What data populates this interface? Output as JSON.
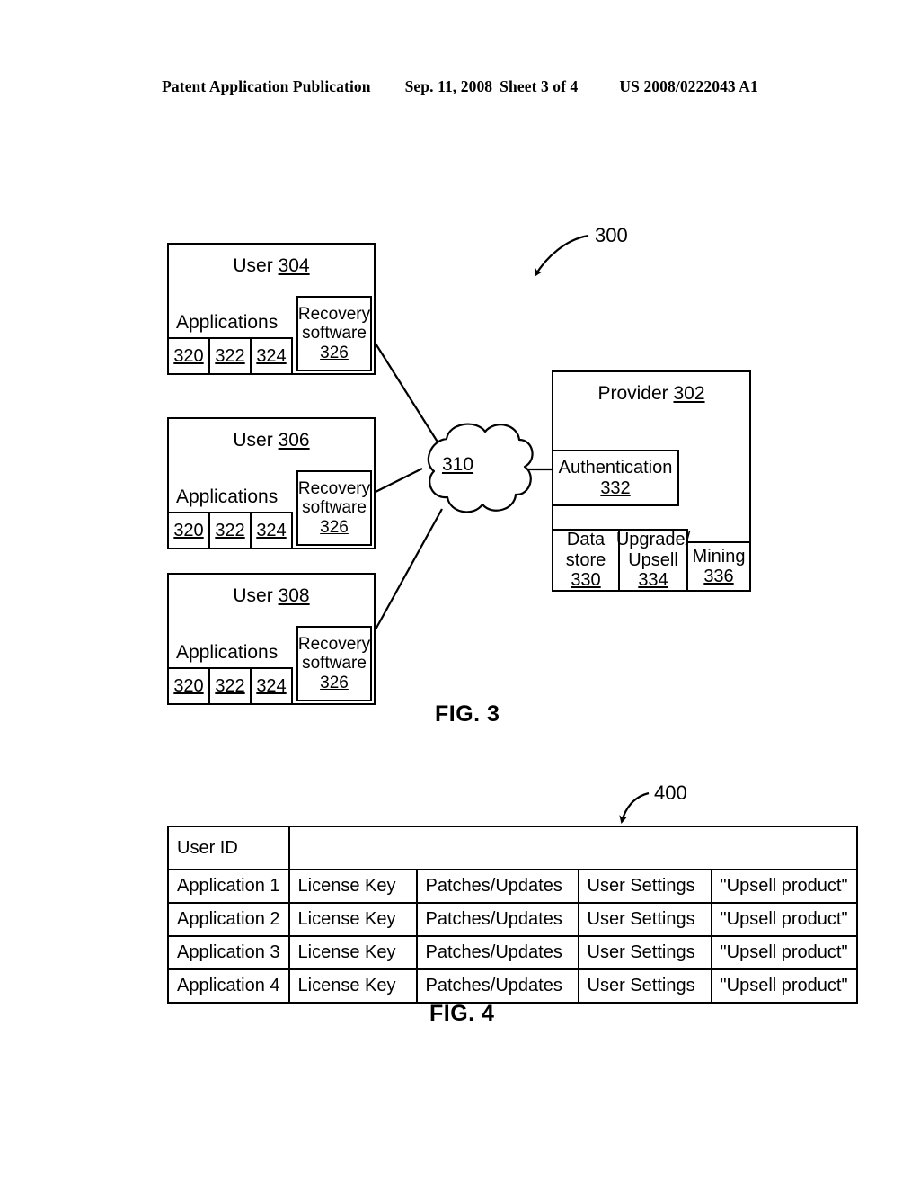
{
  "header": {
    "publication": "Patent Application Publication",
    "date": "Sep. 11, 2008",
    "sheet": "Sheet 3 of 4",
    "patent_number": "US 2008/0222043 A1"
  },
  "figure3": {
    "caption": "FIG. 3",
    "reference_label": "300",
    "cloud": {
      "name": "network-cloud",
      "label": "310"
    },
    "users": [
      {
        "title_text": "User",
        "title_ref": "304",
        "applications_label": "Applications",
        "app_refs": [
          "320",
          "322",
          "324"
        ],
        "recovery": {
          "line1": "Recovery",
          "line2": "software",
          "ref": "326"
        }
      },
      {
        "title_text": "User",
        "title_ref": "306",
        "applications_label": "Applications",
        "app_refs": [
          "320",
          "322",
          "324"
        ],
        "recovery": {
          "line1": "Recovery",
          "line2": "software",
          "ref": "326"
        }
      },
      {
        "title_text": "User",
        "title_ref": "308",
        "applications_label": "Applications",
        "app_refs": [
          "320",
          "322",
          "324"
        ],
        "recovery": {
          "line1": "Recovery",
          "line2": "software",
          "ref": "326"
        }
      }
    ],
    "provider": {
      "title_text": "Provider",
      "title_ref": "302",
      "authentication": {
        "label": "Authentication",
        "ref": "332"
      },
      "modules": [
        {
          "line1": "Data",
          "line2": "store",
          "ref": "330"
        },
        {
          "line1": "Upgrade/",
          "line2": "Upsell",
          "ref": "334"
        },
        {
          "line1": "Mining",
          "line2": "",
          "ref": "336"
        }
      ]
    }
  },
  "figure4": {
    "caption": "FIG. 4",
    "reference_label": "400",
    "table": {
      "header_row": [
        "User ID",
        ""
      ],
      "rows": [
        [
          "Application 1",
          "License Key",
          "Patches/Updates",
          "User Settings",
          "\"Upsell product\""
        ],
        [
          "Application 2",
          "License Key",
          "Patches/Updates",
          "User Settings",
          "\"Upsell product\""
        ],
        [
          "Application 3",
          "License Key",
          "Patches/Updates",
          "User Settings",
          "\"Upsell product\""
        ],
        [
          "Application 4",
          "License Key",
          "Patches/Updates",
          "User Settings",
          "\"Upsell product\""
        ]
      ]
    }
  },
  "colors": {
    "ink": "#000000",
    "paper": "#ffffff"
  }
}
